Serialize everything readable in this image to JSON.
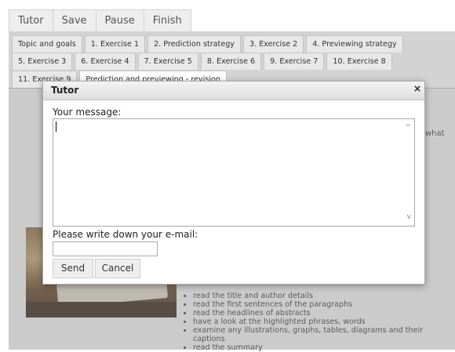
{
  "toolbar": {
    "buttons": [
      "Tutor",
      "Save",
      "Pause",
      "Finish"
    ]
  },
  "tabs": {
    "row1": [
      "Topic and goals",
      "1. Exercise 1",
      "2. Prediction strategy",
      "3. Exercise 2",
      "4. Previewing strategy"
    ],
    "row2": [
      "5. Exercise 3",
      "6. Exercise 4",
      "7. Exercise 5",
      "8. Exercise 6",
      "9. Exercise 7",
      "10. Exercise 8"
    ],
    "row3": [
      "11. Exercise 9",
      "Prediction and previewing - revision"
    ]
  },
  "content": {
    "side_fragment": "what",
    "bullets": [
      "read the title and author details",
      "read the first sentences of the paragraphs",
      "read the headlines of abstracts",
      "have a look at the highlighted phrases, words",
      "examine any illustrations, graphs, tables, diagrams and their captions",
      "read the summary"
    ]
  },
  "dialog": {
    "title": "Tutor",
    "close_glyph": "×",
    "message_label": "Your message:",
    "message_value": "",
    "email_label": "Please write down your e-mail:",
    "email_value": "",
    "send_label": "Send",
    "cancel_label": "Cancel",
    "scroll_up_glyph": "^",
    "scroll_down_glyph": "v"
  }
}
